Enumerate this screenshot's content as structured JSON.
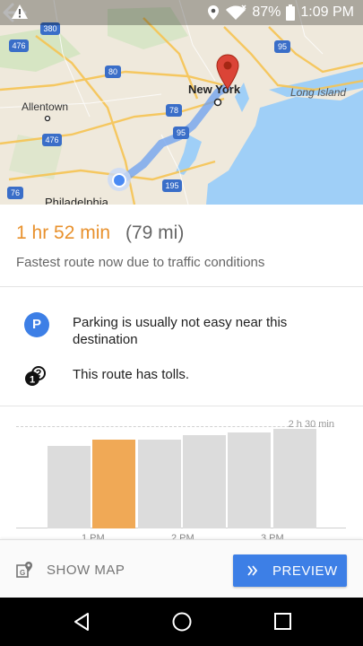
{
  "status_bar": {
    "battery": "87%",
    "time": "1:09 PM",
    "icons": [
      "warning-icon",
      "location-icon",
      "wifi-icon",
      "battery-icon"
    ]
  },
  "map": {
    "labels": {
      "new_york": "New York",
      "long_island": "Long Island",
      "allentown": "Allentown",
      "philadelphia": "Philadelphia"
    },
    "shields": {
      "i476_top": "476",
      "i380": "380",
      "i80": "80",
      "i78": "78",
      "i95_top": "95",
      "i95_mid": "95",
      "i476": "476",
      "i76": "76",
      "i195": "195"
    },
    "colors": {
      "water": "#9fcff7",
      "land": "#efe9dc",
      "route": "#4a8af4",
      "pin": "#db4437"
    }
  },
  "route": {
    "duration": "1 hr 52 min",
    "distance": "(79 mi)",
    "description": "Fastest route now due to traffic conditions"
  },
  "notices": {
    "parking_icon": "P",
    "parking": "Parking is usually not easy near this destination",
    "tolls": "This route has tolls."
  },
  "traffic_chart": {
    "max_label": "2 h 30 min",
    "ticks": [
      "1 PM",
      "2 PM",
      "3 PM"
    ],
    "selected_index": 1
  },
  "chart_data": {
    "type": "bar",
    "categories": [
      "",
      "",
      "",
      "",
      "",
      ""
    ],
    "values": [
      0.83,
      0.89,
      0.89,
      0.94,
      0.97,
      1.0
    ],
    "ylim": [
      0,
      1.03
    ],
    "ticks": [
      "1 PM",
      "2 PM",
      "3 PM"
    ]
  },
  "actions": {
    "show_map": "SHOW MAP",
    "preview": "PREVIEW",
    "accent": "#3d7fe6"
  }
}
